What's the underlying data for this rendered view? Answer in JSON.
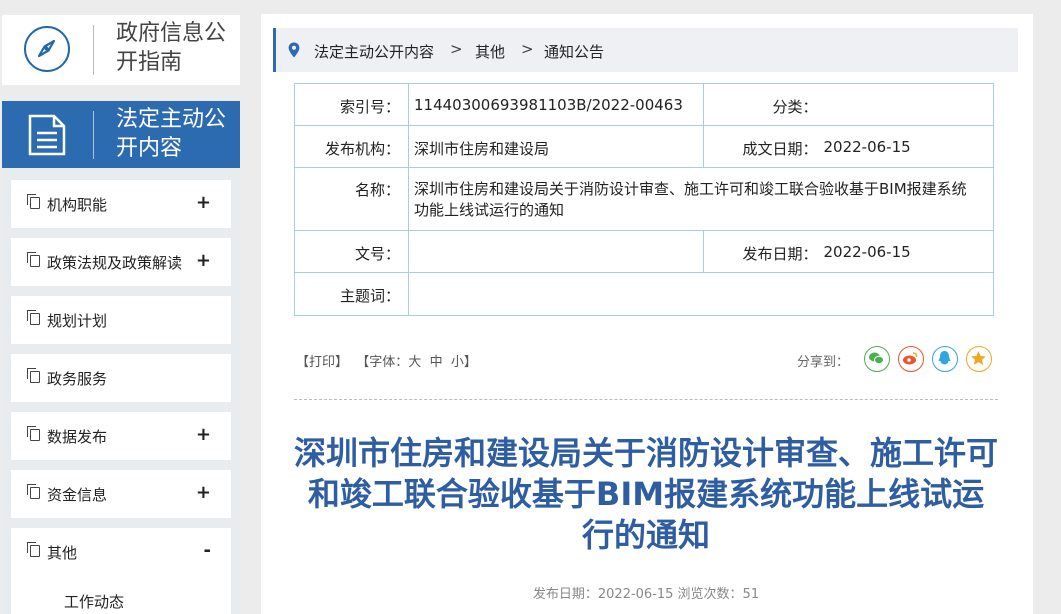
{
  "sidebar": {
    "guide_title": "政府信息公开指南",
    "active_title": "法定主动公开内容",
    "items": [
      {
        "label": "机构职能",
        "toggle": "+"
      },
      {
        "label": "政策法规及政策解读",
        "toggle": "+"
      },
      {
        "label": "规划计划",
        "toggle": ""
      },
      {
        "label": "政务服务",
        "toggle": ""
      },
      {
        "label": "数据发布",
        "toggle": "+"
      },
      {
        "label": "资金信息",
        "toggle": "+"
      },
      {
        "label": "其他",
        "toggle": "-"
      }
    ],
    "sub_items": [
      "工作动态"
    ]
  },
  "breadcrumb": [
    "法定主动公开内容",
    "其他",
    "通知公告"
  ],
  "meta": {
    "index_label": "索引号：",
    "index_value": "11440300693981103B/2022-00463",
    "category_label": "分类：",
    "category_value": "",
    "publisher_label": "发布机构：",
    "publisher_value": "深圳市住房和建设局",
    "written_date_label": "成文日期：",
    "written_date_value": "2022-06-15",
    "name_label": "名称：",
    "name_value": "深圳市住房和建设局关于消防设计审查、施工许可和竣工联合验收基于BIM报建系统功能上线试运行的通知",
    "doc_no_label": "文号：",
    "doc_no_value": "",
    "publish_date_label": "发布日期：",
    "publish_date_value": "2022-06-15",
    "keywords_label": "主题词：",
    "keywords_value": ""
  },
  "tools": {
    "print": "【打印】",
    "font_prefix": "【字体：",
    "font_large": "大",
    "font_medium": "中",
    "font_small": "小",
    "font_suffix": "】",
    "share_label": "分享到："
  },
  "share_icons": [
    {
      "name": "wechat-icon",
      "color": "#4caf50"
    },
    {
      "name": "weibo-icon",
      "color": "#e8552e"
    },
    {
      "name": "qq-icon",
      "color": "#2ea7e0"
    },
    {
      "name": "qzone-icon",
      "color": "#f0a81c"
    }
  ],
  "article": {
    "title": "深圳市住房和建设局关于消防设计审查、施工许可和竣工联合验收基于BIM报建系统功能上线试运行的通知",
    "info": "发布日期：2022-06-15 浏览次数：51"
  },
  "colors": {
    "accent": "#2d6bb0",
    "title": "#2e5ea1",
    "table_border": "#a9cde6"
  }
}
